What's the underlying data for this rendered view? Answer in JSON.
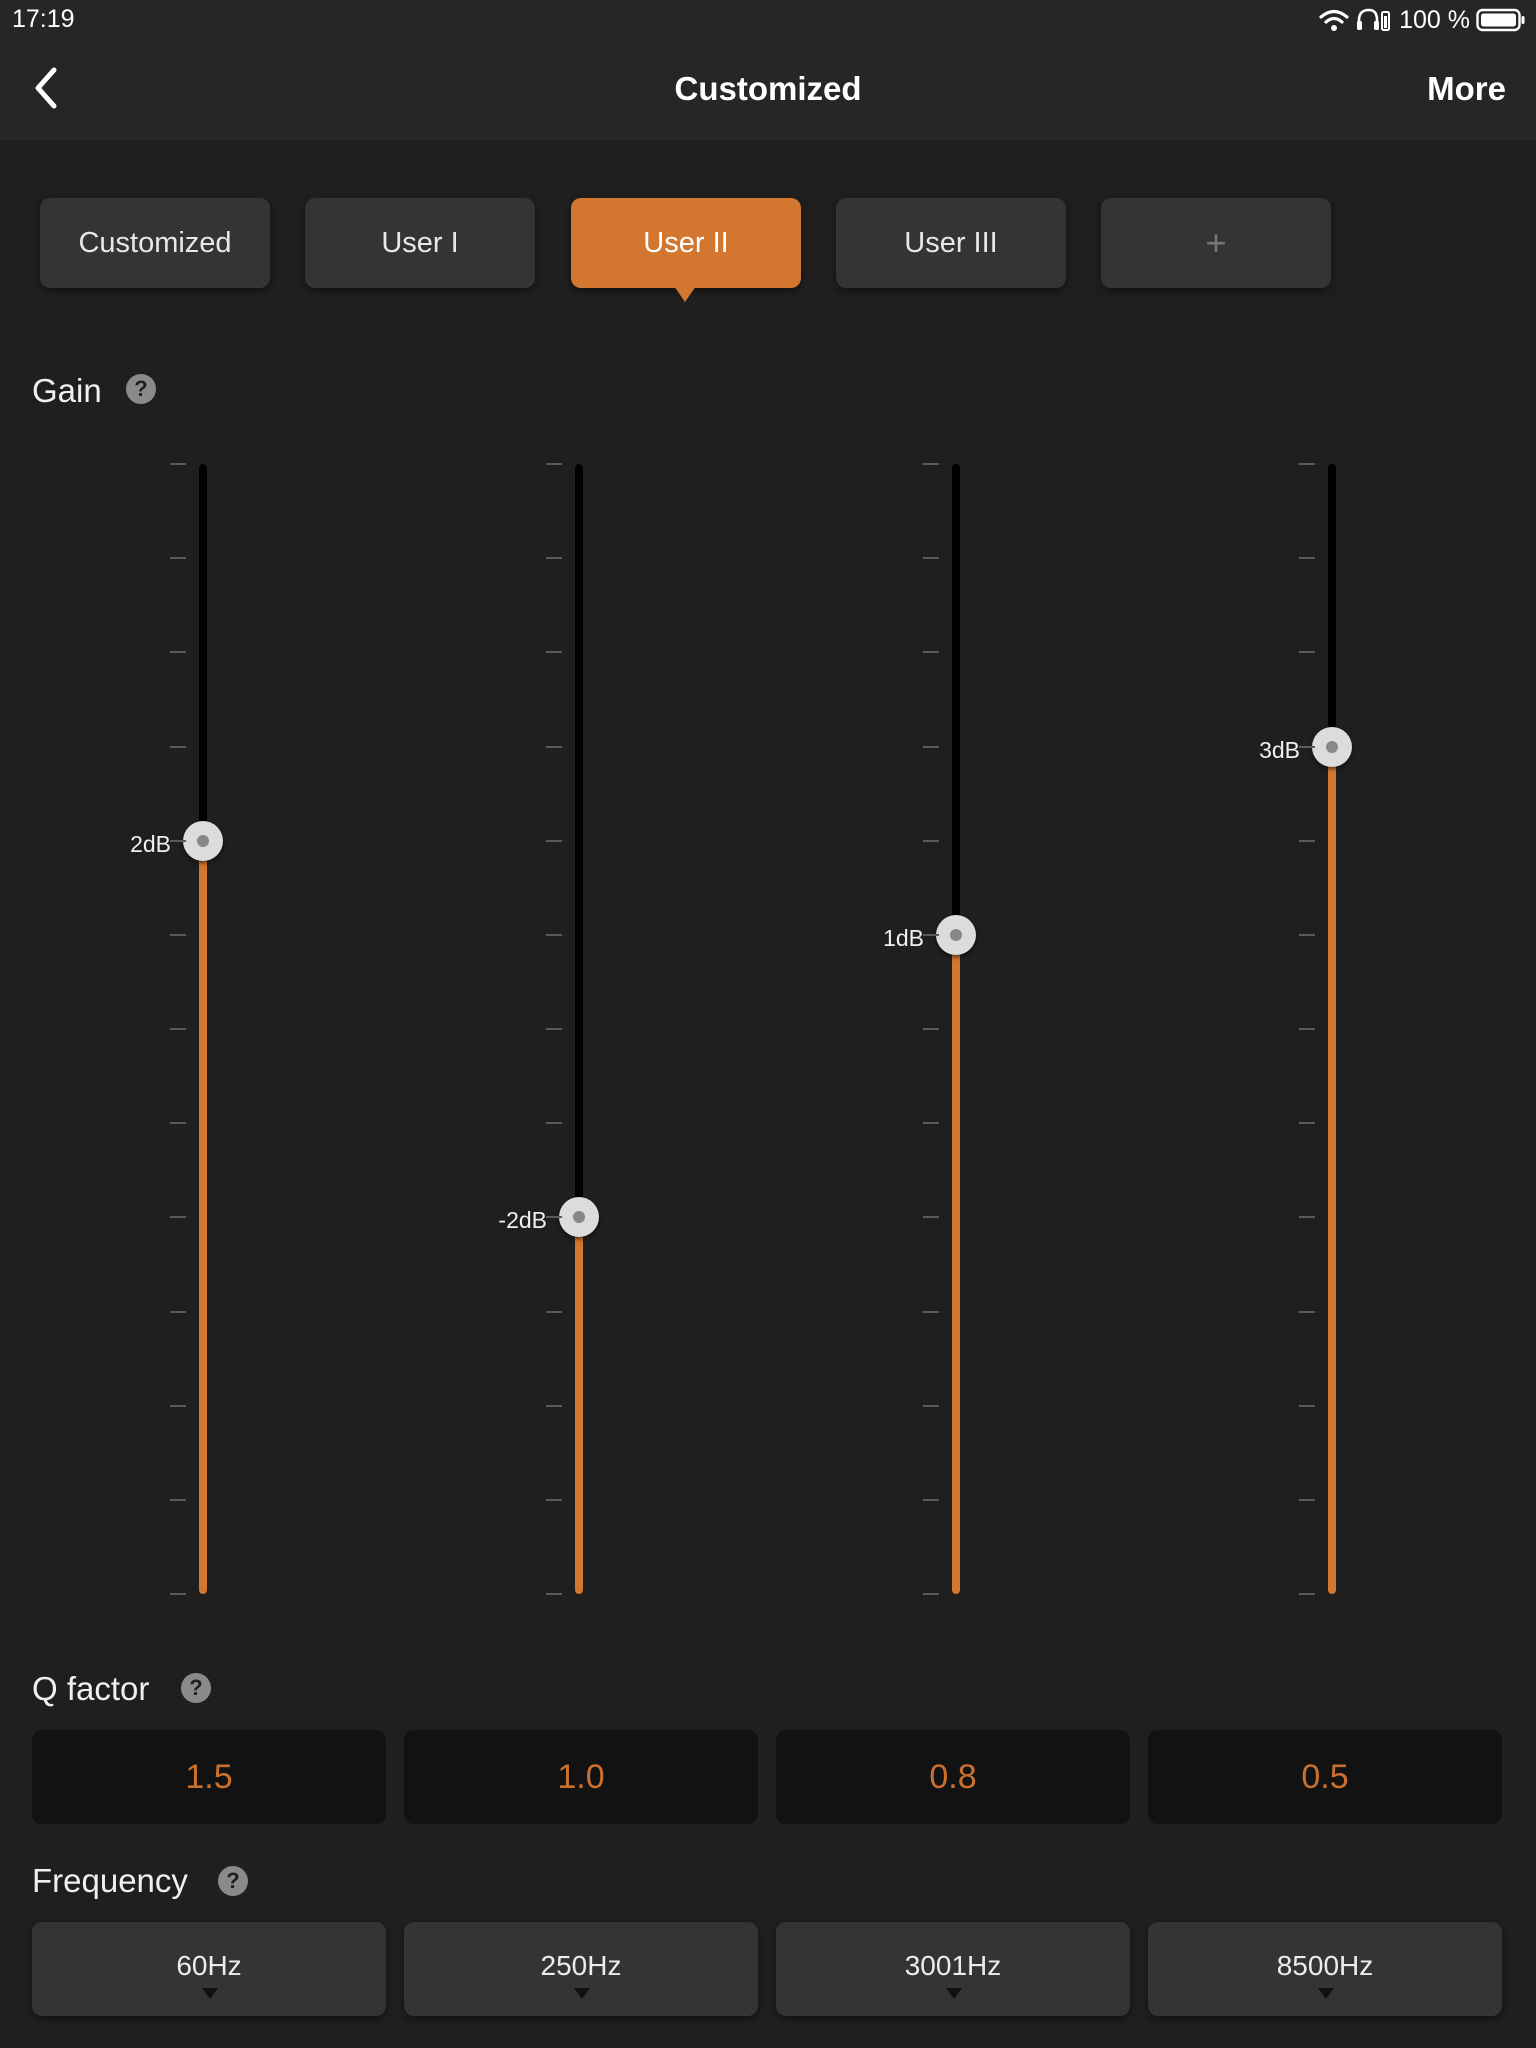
{
  "status_bar": {
    "time": "17:19",
    "battery_text": "100 %",
    "icons": [
      "wifi-icon",
      "headphones-icon",
      "battery-icon"
    ]
  },
  "nav": {
    "title": "Customized",
    "more_label": "More",
    "back_icon": "chevron-left-icon"
  },
  "presets": [
    {
      "label": "Customized",
      "active": false
    },
    {
      "label": "User I",
      "active": false
    },
    {
      "label": "User II",
      "active": true
    },
    {
      "label": "User III",
      "active": false
    },
    {
      "label": "+",
      "active": false
    }
  ],
  "gain": {
    "label": "Gain",
    "help": "?",
    "min_db": -6,
    "max_db": 6,
    "bands": [
      {
        "value_db": 2,
        "label": "2dB"
      },
      {
        "value_db": -2,
        "label": "-2dB"
      },
      {
        "value_db": 1,
        "label": "1dB"
      },
      {
        "value_db": 3,
        "label": "3dB"
      }
    ]
  },
  "q_factor": {
    "label": "Q factor",
    "help": "?",
    "values": [
      "1.5",
      "1.0",
      "0.8",
      "0.5"
    ]
  },
  "frequency": {
    "label": "Frequency",
    "help": "?",
    "values": [
      "60Hz",
      "250Hz",
      "3001Hz",
      "8500Hz"
    ]
  },
  "colors": {
    "accent": "#d27630",
    "background": "#1f1f1f",
    "bar": "#262626",
    "card": "#343434"
  }
}
